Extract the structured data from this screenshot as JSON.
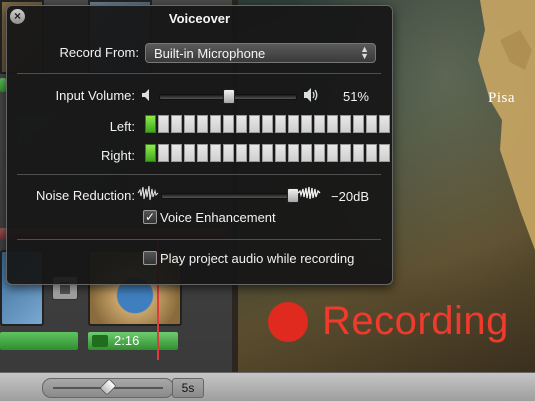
{
  "hud": {
    "title": "Voiceover",
    "close_glyph": "×",
    "record_from_label": "Record From:",
    "record_from_value": "Built-in Microphone",
    "input_volume_label": "Input Volume:",
    "input_volume_value": "51%",
    "input_volume_level": 0.51,
    "left_label": "Left:",
    "right_label": "Right:",
    "left_meter_active_segments": 1,
    "right_meter_active_segments": 1,
    "meter_segment_count": 19,
    "noise_reduction_label": "Noise Reduction:",
    "noise_reduction_value": "−20dB",
    "voice_enhancement_label": "Voice Enhancement",
    "voice_enhancement_checked": true,
    "play_audio_label": "Play project audio while recording",
    "play_audio_checked": false
  },
  "timeline": {
    "clip_time": "2:16",
    "zoom_value": "5s"
  },
  "viewer": {
    "map_label": "Pisa",
    "recording_label": "Recording",
    "recording_color": "#e02a20"
  },
  "icons": {
    "speaker_low": "speaker-low-icon",
    "speaker_high": "speaker-high-icon",
    "waveform_small": "waveform-small-icon",
    "waveform_large": "waveform-large-icon"
  }
}
